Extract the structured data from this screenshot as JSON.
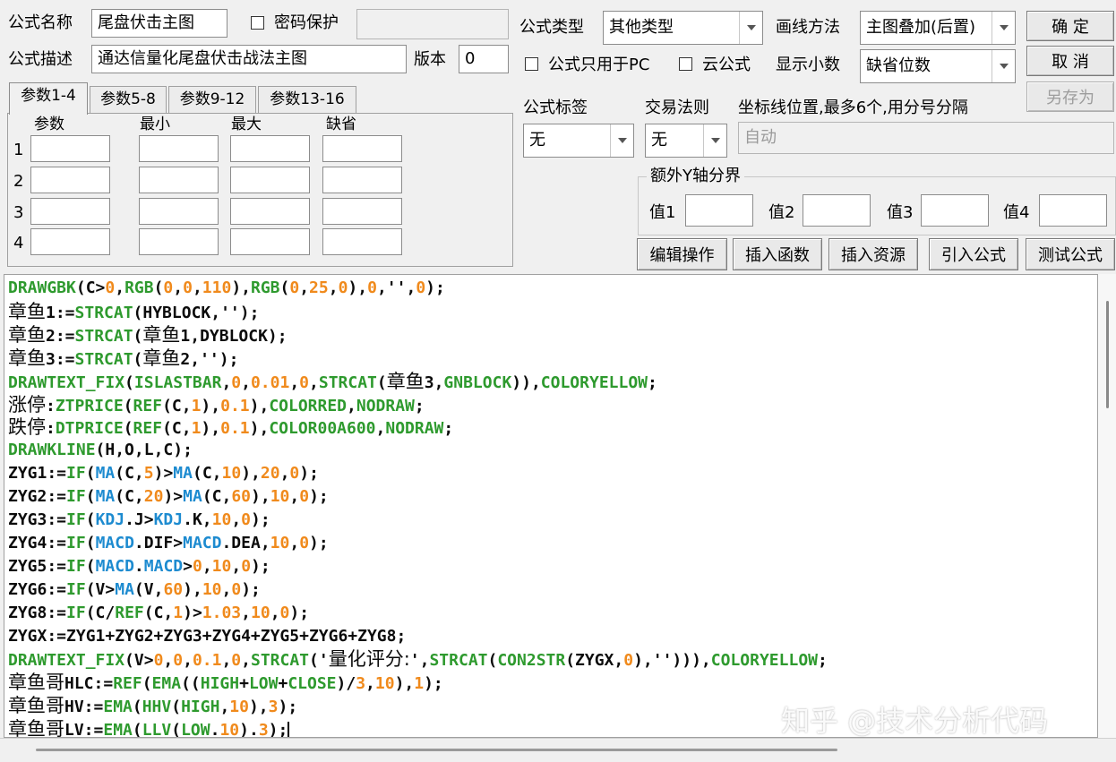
{
  "form": {
    "name_label": "公式名称",
    "name_value": "尾盘伏击主图",
    "password_label": "密码保护",
    "password_value": "",
    "desc_label": "公式描述",
    "desc_value": "通达信量化尾盘伏击战法主图",
    "version_label": "版本",
    "version_value": "0",
    "type_label": "公式类型",
    "type_value": "其他类型",
    "draw_label": "画线方法",
    "draw_value": "主图叠加(后置)",
    "pc_only_label": "公式只用于PC",
    "cloud_label": "云公式",
    "decimals_label": "显示小数",
    "decimals_value": "缺省位数",
    "tag_label": "公式标签",
    "tag_value": "无",
    "rule_label": "交易法则",
    "rule_value": "无",
    "coord_label": "坐标线位置,最多6个,用分号分隔",
    "coord_value": "自动",
    "yaxis_label": "额外Y轴分界",
    "y_values": [
      {
        "label": "值1",
        "value": ""
      },
      {
        "label": "值2",
        "value": ""
      },
      {
        "label": "值3",
        "value": ""
      },
      {
        "label": "值4",
        "value": ""
      }
    ]
  },
  "buttons": {
    "ok": "确  定",
    "cancel": "取  消",
    "save_as": "另存为",
    "edit": "编辑操作",
    "insert_func": "插入函数",
    "insert_res": "插入资源",
    "import": "引入公式",
    "test": "测试公式"
  },
  "params": {
    "tabs": [
      "参数1-4",
      "参数5-8",
      "参数9-12",
      "参数13-16"
    ],
    "headers": [
      "参数",
      "最小",
      "最大",
      "缺省"
    ],
    "rows": [
      "1",
      "2",
      "3",
      "4"
    ]
  },
  "code_lines": [
    [
      [
        "DRAWGBK",
        "f"
      ],
      [
        "(C>",
        ""
      ],
      [
        "0",
        "n"
      ],
      [
        ",",
        ""
      ],
      [
        "RGB",
        "f"
      ],
      [
        "(",
        ""
      ],
      [
        "0",
        "n"
      ],
      [
        ",",
        ""
      ],
      [
        "0",
        "n"
      ],
      [
        ",",
        ""
      ],
      [
        "110",
        "n"
      ],
      [
        "),",
        ""
      ],
      [
        "RGB",
        "f"
      ],
      [
        "(",
        ""
      ],
      [
        "0",
        "n"
      ],
      [
        ",",
        ""
      ],
      [
        "25",
        "n"
      ],
      [
        ",",
        ""
      ],
      [
        "0",
        "n"
      ],
      [
        "),",
        ""
      ],
      [
        "0",
        "n"
      ],
      [
        ",'',",
        ""
      ],
      [
        "0",
        "n"
      ],
      [
        ");",
        ""
      ]
    ],
    [
      [
        "章鱼",
        "c"
      ],
      [
        "1:=",
        ""
      ],
      [
        "STRCAT",
        "f"
      ],
      [
        "(HYBLOCK,'');",
        ""
      ]
    ],
    [
      [
        "章鱼",
        "c"
      ],
      [
        "2:=",
        ""
      ],
      [
        "STRCAT",
        "f"
      ],
      [
        "(",
        ""
      ],
      [
        "章鱼",
        "c"
      ],
      [
        "1,DYBLOCK);",
        ""
      ]
    ],
    [
      [
        "章鱼",
        "c"
      ],
      [
        "3:=",
        ""
      ],
      [
        "STRCAT",
        "f"
      ],
      [
        "(",
        ""
      ],
      [
        "章鱼",
        "c"
      ],
      [
        "2,'');",
        ""
      ]
    ],
    [
      [
        "DRAWTEXT_FIX",
        "f"
      ],
      [
        "(",
        ""
      ],
      [
        "ISLASTBAR",
        "f"
      ],
      [
        ",",
        ""
      ],
      [
        "0",
        "n"
      ],
      [
        ",",
        ""
      ],
      [
        "0.01",
        "n"
      ],
      [
        ",",
        ""
      ],
      [
        "0",
        "n"
      ],
      [
        ",",
        ""
      ],
      [
        "STRCAT",
        "f"
      ],
      [
        "(",
        ""
      ],
      [
        "章鱼",
        "c"
      ],
      [
        "3,",
        ""
      ],
      [
        "GNBLOCK",
        "f"
      ],
      [
        ")),",
        ""
      ],
      [
        "COLORYELLOW",
        "f"
      ],
      [
        ";",
        ""
      ]
    ],
    [
      [
        "涨停",
        "c"
      ],
      [
        ":",
        ""
      ],
      [
        "ZTPRICE",
        "f"
      ],
      [
        "(",
        ""
      ],
      [
        "REF",
        "f"
      ],
      [
        "(C,",
        ""
      ],
      [
        "1",
        "n"
      ],
      [
        "),",
        ""
      ],
      [
        "0.1",
        "n"
      ],
      [
        "),",
        ""
      ],
      [
        "COLORRED",
        "f"
      ],
      [
        ",",
        ""
      ],
      [
        "NODRAW",
        "f"
      ],
      [
        ";",
        ""
      ]
    ],
    [
      [
        "跌停",
        "c"
      ],
      [
        ":",
        ""
      ],
      [
        "DTPRICE",
        "f"
      ],
      [
        "(",
        ""
      ],
      [
        "REF",
        "f"
      ],
      [
        "(C,",
        ""
      ],
      [
        "1",
        "n"
      ],
      [
        "),",
        ""
      ],
      [
        "0.1",
        "n"
      ],
      [
        "),",
        ""
      ],
      [
        "COLOR00A600",
        "f"
      ],
      [
        ",",
        ""
      ],
      [
        "NODRAW",
        "f"
      ],
      [
        ";",
        ""
      ]
    ],
    [
      [
        "DRAWKLINE",
        "f"
      ],
      [
        "(H,O,L,C);",
        ""
      ]
    ],
    [
      [
        "ZYG1:=",
        ""
      ],
      [
        "IF",
        "f"
      ],
      [
        "(",
        ""
      ],
      [
        "MA",
        "v"
      ],
      [
        "(C,",
        ""
      ],
      [
        "5",
        "n"
      ],
      [
        ")>",
        ""
      ],
      [
        "MA",
        "v"
      ],
      [
        "(C,",
        ""
      ],
      [
        "10",
        "n"
      ],
      [
        "),",
        ""
      ],
      [
        "20",
        "n"
      ],
      [
        ",",
        ""
      ],
      [
        "0",
        "n"
      ],
      [
        ");",
        ""
      ]
    ],
    [
      [
        "ZYG2:=",
        ""
      ],
      [
        "IF",
        "f"
      ],
      [
        "(",
        ""
      ],
      [
        "MA",
        "v"
      ],
      [
        "(C,",
        ""
      ],
      [
        "20",
        "n"
      ],
      [
        ")>",
        ""
      ],
      [
        "MA",
        "v"
      ],
      [
        "(C,",
        ""
      ],
      [
        "60",
        "n"
      ],
      [
        "),",
        ""
      ],
      [
        "10",
        "n"
      ],
      [
        ",",
        ""
      ],
      [
        "0",
        "n"
      ],
      [
        ");",
        ""
      ]
    ],
    [
      [
        "ZYG3:=",
        ""
      ],
      [
        "IF",
        "f"
      ],
      [
        "(",
        ""
      ],
      [
        "KDJ",
        "v"
      ],
      [
        ".J>",
        ""
      ],
      [
        "KDJ",
        "v"
      ],
      [
        ".K,",
        ""
      ],
      [
        "10",
        "n"
      ],
      [
        ",",
        ""
      ],
      [
        "0",
        "n"
      ],
      [
        ");",
        ""
      ]
    ],
    [
      [
        "ZYG4:=",
        ""
      ],
      [
        "IF",
        "f"
      ],
      [
        "(",
        ""
      ],
      [
        "MACD",
        "v"
      ],
      [
        ".DIF>",
        ""
      ],
      [
        "MACD",
        "v"
      ],
      [
        ".DEA,",
        ""
      ],
      [
        "10",
        "n"
      ],
      [
        ",",
        ""
      ],
      [
        "0",
        "n"
      ],
      [
        ");",
        ""
      ]
    ],
    [
      [
        "ZYG5:=",
        ""
      ],
      [
        "IF",
        "f"
      ],
      [
        "(",
        ""
      ],
      [
        "MACD",
        "v"
      ],
      [
        ".",
        ""
      ],
      [
        "MACD",
        "v"
      ],
      [
        ">",
        ""
      ],
      [
        "0",
        "n"
      ],
      [
        ",",
        ""
      ],
      [
        "10",
        "n"
      ],
      [
        ",",
        ""
      ],
      [
        "0",
        "n"
      ],
      [
        ");",
        ""
      ]
    ],
    [
      [
        "ZYG6:=",
        ""
      ],
      [
        "IF",
        "f"
      ],
      [
        "(V>",
        ""
      ],
      [
        "MA",
        "v"
      ],
      [
        "(V,",
        ""
      ],
      [
        "60",
        "n"
      ],
      [
        "),",
        ""
      ],
      [
        "10",
        "n"
      ],
      [
        ",",
        ""
      ],
      [
        "0",
        "n"
      ],
      [
        ");",
        ""
      ]
    ],
    [
      [
        "ZYG8:=",
        ""
      ],
      [
        "IF",
        "f"
      ],
      [
        "(C/",
        ""
      ],
      [
        "REF",
        "f"
      ],
      [
        "(C,",
        ""
      ],
      [
        "1",
        "n"
      ],
      [
        ")>",
        ""
      ],
      [
        "1.03",
        "n"
      ],
      [
        ",",
        ""
      ],
      [
        "10",
        "n"
      ],
      [
        ",",
        ""
      ],
      [
        "0",
        "n"
      ],
      [
        ");",
        ""
      ]
    ],
    [
      [
        "ZYGX:=ZYG1+ZYG2+ZYG3+ZYG4+ZYG5+ZYG6+ZYG8;",
        ""
      ]
    ],
    [
      [
        "DRAWTEXT_FIX",
        "f"
      ],
      [
        "(V>",
        ""
      ],
      [
        "0",
        "n"
      ],
      [
        ",",
        ""
      ],
      [
        "0",
        "n"
      ],
      [
        ",",
        ""
      ],
      [
        "0.1",
        "n"
      ],
      [
        ",",
        ""
      ],
      [
        "0",
        "n"
      ],
      [
        ",",
        ""
      ],
      [
        "STRCAT",
        "f"
      ],
      [
        "('",
        ""
      ],
      [
        "量化评分:",
        "c"
      ],
      [
        "',",
        ""
      ],
      [
        "STRCAT",
        "f"
      ],
      [
        "(",
        ""
      ],
      [
        "CON2STR",
        "f"
      ],
      [
        "(ZYGX,",
        ""
      ],
      [
        "0",
        "n"
      ],
      [
        "),''))),",
        ""
      ],
      [
        "COLORYELLOW",
        "f"
      ],
      [
        ";",
        ""
      ]
    ],
    [
      [
        "章鱼哥",
        "c"
      ],
      [
        "HLC:=",
        ""
      ],
      [
        "REF",
        "f"
      ],
      [
        "(",
        ""
      ],
      [
        "EMA",
        "f"
      ],
      [
        "((",
        ""
      ],
      [
        "HIGH",
        "f"
      ],
      [
        "+",
        ""
      ],
      [
        "LOW",
        "f"
      ],
      [
        "+",
        ""
      ],
      [
        "CLOSE",
        "f"
      ],
      [
        ")/",
        ""
      ],
      [
        "3",
        "n"
      ],
      [
        ",",
        ""
      ],
      [
        "10",
        "n"
      ],
      [
        "),",
        ""
      ],
      [
        "1",
        "n"
      ],
      [
        ");",
        ""
      ]
    ],
    [
      [
        "章鱼哥",
        "c"
      ],
      [
        "HV:=",
        ""
      ],
      [
        "EMA",
        "f"
      ],
      [
        "(",
        ""
      ],
      [
        "HHV",
        "f"
      ],
      [
        "(",
        ""
      ],
      [
        "HIGH",
        "f"
      ],
      [
        ",",
        ""
      ],
      [
        "10",
        "n"
      ],
      [
        "),",
        ""
      ],
      [
        "3",
        "n"
      ],
      [
        ");",
        ""
      ]
    ],
    [
      [
        "章鱼哥",
        "c"
      ],
      [
        "LV:=",
        ""
      ],
      [
        "EMA",
        "f"
      ],
      [
        "(",
        ""
      ],
      [
        "LLV",
        "f"
      ],
      [
        "(",
        ""
      ],
      [
        "LOW",
        "f"
      ],
      [
        ".",
        ""
      ],
      [
        "10",
        "n"
      ],
      [
        ").",
        ""
      ],
      [
        "3",
        "n"
      ],
      [
        ");",
        ""
      ]
    ]
  ],
  "watermark": "知乎 @技术分析代码"
}
